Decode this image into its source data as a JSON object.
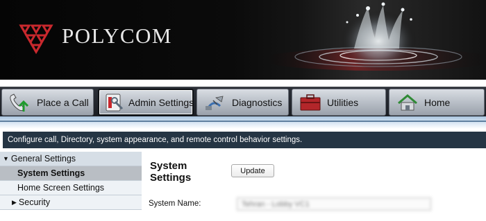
{
  "brand": {
    "name": "POLYCOM"
  },
  "nav": {
    "items": [
      {
        "label": "Place a Call",
        "icon": "phone-call-icon",
        "active": false
      },
      {
        "label": "Admin Settings",
        "icon": "admin-settings-icon",
        "active": true
      },
      {
        "label": "Diagnostics",
        "icon": "diagnostics-icon",
        "active": false
      },
      {
        "label": "Utilities",
        "icon": "utilities-icon",
        "active": false
      },
      {
        "label": "Home",
        "icon": "home-icon",
        "active": false
      }
    ]
  },
  "description": "Configure call, Directory, system appearance, and remote control behavior settings.",
  "sidebar": {
    "group_label": "General Settings",
    "items": [
      {
        "label": "System Settings",
        "selected": true
      },
      {
        "label": "Home Screen Settings",
        "selected": false
      },
      {
        "label": "Security",
        "selected": false
      }
    ]
  },
  "main": {
    "title": "System Settings",
    "update_label": "Update",
    "system_name_label": "System Name:",
    "system_name_value": "Tehran - Lobby VC1"
  },
  "colors": {
    "accent_red": "#c8282d",
    "nav_dark": "#1b1e24",
    "desc_bar": "#253544"
  }
}
